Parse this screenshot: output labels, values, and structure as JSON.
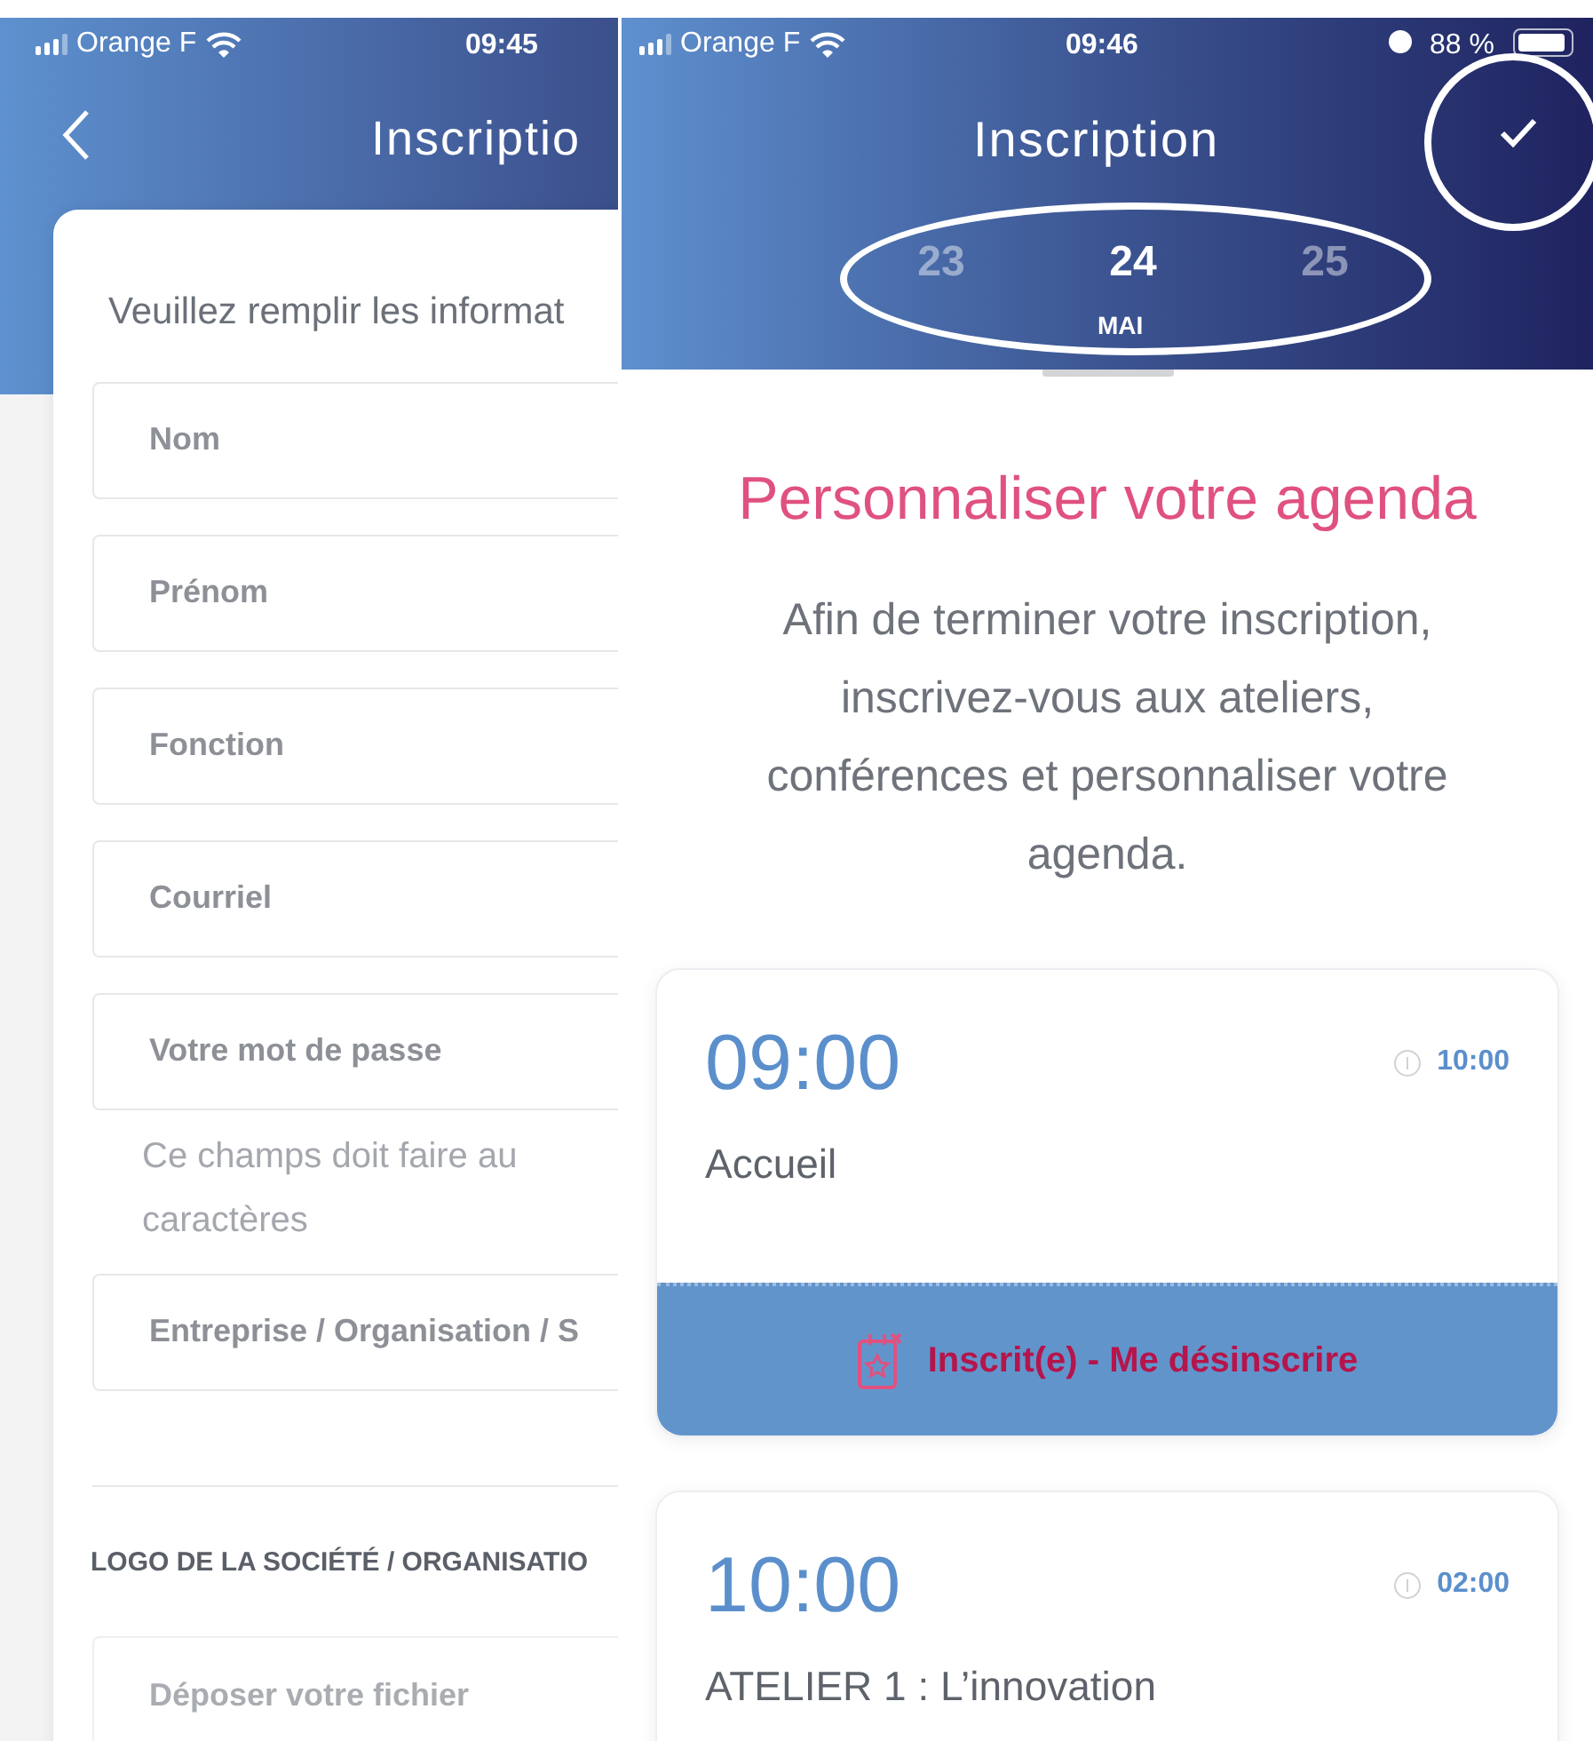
{
  "left_screen": {
    "status_bar": {
      "carrier": "Orange F",
      "time": "09:45"
    },
    "header": {
      "title": "Inscriptio"
    },
    "form": {
      "intro": "Veuillez remplir les informat",
      "fields": [
        {
          "placeholder": "Nom"
        },
        {
          "placeholder": "Prénom"
        },
        {
          "placeholder": "Fonction"
        },
        {
          "placeholder": "Courriel"
        },
        {
          "placeholder": "Votre mot de passe",
          "hint": [
            "Ce champs doit faire au",
            "caractères"
          ]
        },
        {
          "placeholder": "Entreprise / Organisation / S"
        }
      ],
      "logo_section": {
        "label": "LOGO DE LA SOCIÉTÉ / ORGANISATIO",
        "file_field": {
          "placeholder": "Déposer votre fichier"
        }
      }
    }
  },
  "right_screen": {
    "status_bar": {
      "carrier": "Orange F",
      "time": "09:46",
      "battery": "88 %"
    },
    "header": {
      "title": "Inscription"
    },
    "date_picker": {
      "days": [
        {
          "label": "23",
          "selected": false
        },
        {
          "label": "24",
          "selected": true
        },
        {
          "label": "25",
          "selected": false
        }
      ],
      "month": "MAI"
    },
    "heading": "Personnaliser votre agenda",
    "intro": "Afin de terminer votre inscription, inscrivez-vous aux ateliers, conférences et personnaliser votre agenda.",
    "sessions": [
      {
        "start": "09:00",
        "duration": "10:00",
        "title": "Accueil",
        "action": "Inscrit(e) - Me désinscrire"
      },
      {
        "start": "10:00",
        "duration": "02:00",
        "title": "ATELIER 1 : L’innovation"
      }
    ]
  }
}
